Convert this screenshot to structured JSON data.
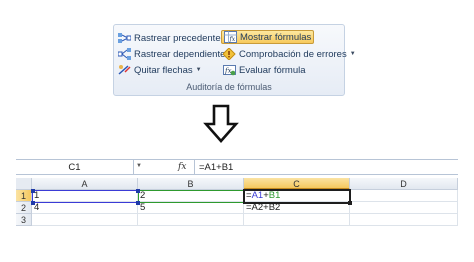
{
  "ribbon": {
    "buttons": {
      "trace_precedents": "Rastrear precedentes",
      "trace_dependents": "Rastrear dependientes",
      "remove_arrows": "Quitar flechas",
      "show_formulas": "Mostrar fórmulas",
      "error_checking": "Comprobación de errores",
      "evaluate_formula": "Evaluar fórmula"
    },
    "group_label": "Auditoría de fórmulas"
  },
  "formula_bar": {
    "name_box": "C1",
    "fx": "fx",
    "formula": "=A1+B1"
  },
  "sheet": {
    "columns": [
      "A",
      "B",
      "C",
      "D"
    ],
    "rows": [
      {
        "num": "1",
        "cells": [
          "1",
          "2",
          "=A1+B1",
          ""
        ]
      },
      {
        "num": "2",
        "cells": [
          "4",
          "5",
          "=A2+B2",
          ""
        ]
      },
      {
        "num": "3",
        "cells": [
          "",
          "",
          "",
          ""
        ]
      }
    ],
    "formula_c1": {
      "prefix": "=",
      "a_ref": "A1",
      "plus": "+",
      "b_ref": "B1"
    }
  },
  "colors": {
    "ref_a": "#3b3bd6",
    "ref_b": "#2e9a2e",
    "selection": "#f5c85f"
  }
}
